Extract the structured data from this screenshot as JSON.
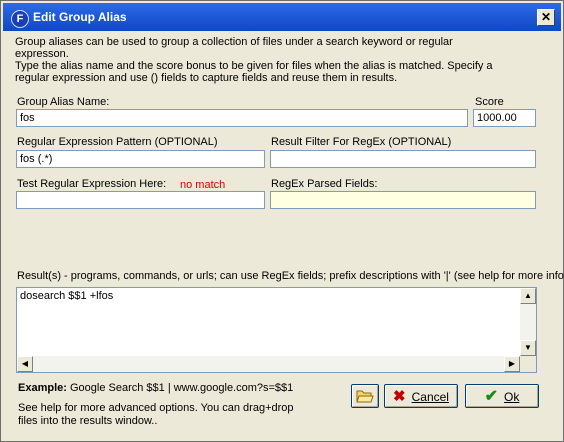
{
  "window": {
    "title": "Edit Group Alias",
    "app_icon_letter": "F",
    "close_glyph": "✕"
  },
  "description": {
    "line1": "Group aliases can be used to group a collection of files under a search keyword or regular",
    "line2": "expresson.",
    "line3": "Type the alias name and the score bonus to be given for files when the alias is matched.  Specify a",
    "line4": "regular expression and use () fields to capture fields and reuse them in results."
  },
  "alias": {
    "label": "Group Alias Name:",
    "value": "fos"
  },
  "score": {
    "label": "Score",
    "value": "1000.00"
  },
  "regex": {
    "label": "Regular Expression Pattern (OPTIONAL)",
    "value": "fos (.*)"
  },
  "result_filter": {
    "label": "Result Filter For RegEx (OPTIONAL)",
    "value": ""
  },
  "test": {
    "label": "Test Regular Expression Here:",
    "status": "no match",
    "status_color": "#e00000",
    "value": ""
  },
  "parsed": {
    "label": "RegEx Parsed Fields:",
    "value": "",
    "bg_color": "#ffffe1"
  },
  "results": {
    "label": "Result(s) - programs, commands, or urls; can use RegEx fields; prefix descriptions with '|' (see help for more info)",
    "value": "dosearch $$1 +lfos"
  },
  "example": {
    "prefix": "Example:",
    "text": "Google Search $$1 | www.google.com?s=$$1"
  },
  "help": {
    "line1": "See help for more advanced options.  You can drag+drop",
    "line2": "files into the results window.."
  },
  "buttons": {
    "browse_icon": "folder-open-icon",
    "cancel_label": "Cancel",
    "cancel_color": "#c00000",
    "ok_label": "Ok",
    "ok_color": "#1a8a1a"
  }
}
